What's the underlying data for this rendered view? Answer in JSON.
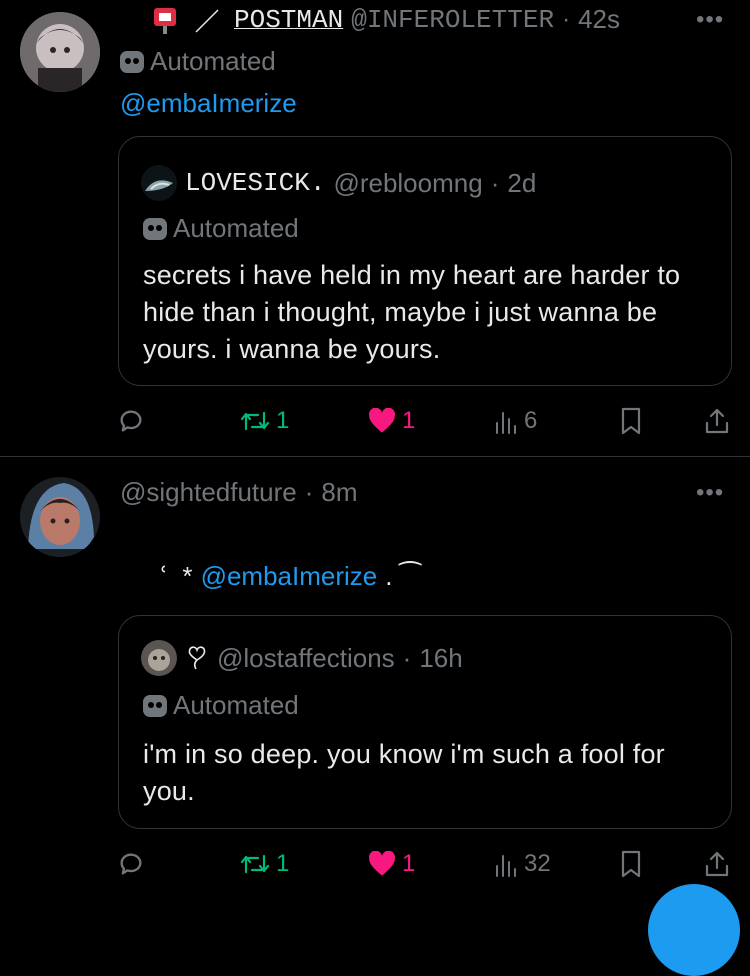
{
  "tweets": [
    {
      "display_name": "POSTMAN",
      "handle": "@INFEROLETTER",
      "time": "42s",
      "automated": "Automated",
      "reply_text": "@embaImerize",
      "quote": {
        "display_name": "LOVESICK.",
        "handle": "@rebloomng",
        "time": "2d",
        "automated": "Automated",
        "text": "secrets i have held in my heart are harder to hide than i thought, maybe i just wanna be yours. i wanna be yours."
      },
      "actions": {
        "reposts": "1",
        "likes": "1",
        "views": "6"
      }
    },
    {
      "handle": "@sightedfuture",
      "time": "8m",
      "reply_prefix": "ՙ  *",
      "reply_mention": "@embaImerize",
      "reply_suffix": ". ⁀",
      "quote": {
        "handle": "@lostaffections",
        "time": "16h",
        "automated": "Automated",
        "text": "i'm in so deep. you know i'm such a fool for you."
      },
      "actions": {
        "reposts": "1",
        "likes": "1",
        "views": "32"
      }
    }
  ],
  "colors": {
    "accent": "#1d9bf0",
    "repost": "#00ba7c",
    "like": "#f91880",
    "muted": "#71767b",
    "border": "#2f3336"
  },
  "icons": [
    "mailbox-icon",
    "bot-icon",
    "reply-icon",
    "repost-icon",
    "heart-icon",
    "views-icon",
    "bookmark-icon",
    "share-icon",
    "more-icon",
    "heart-outline-icon"
  ]
}
